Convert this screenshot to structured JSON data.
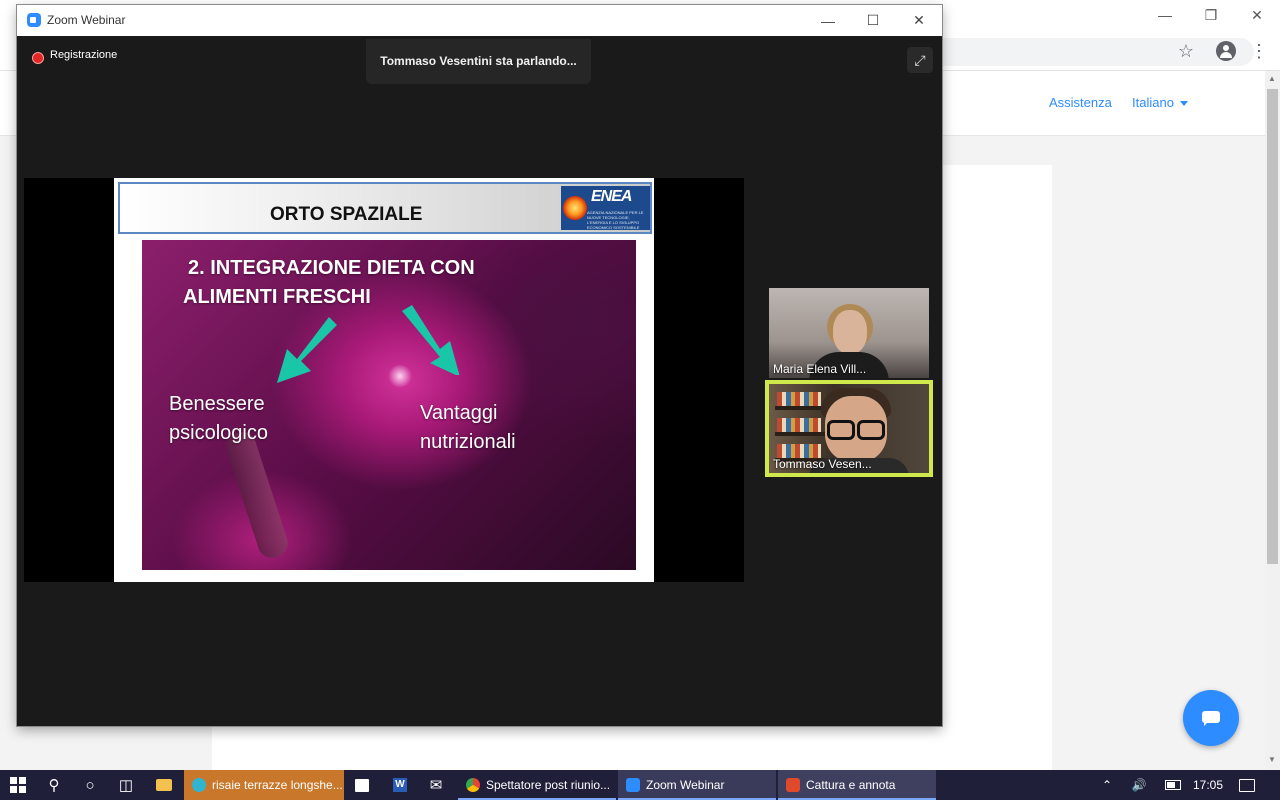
{
  "zoom": {
    "title": "Zoom Webinar",
    "recording_label": "Registrazione",
    "speaking_toast": "Tommaso Vesentini sta parlando..."
  },
  "browser": {
    "nav_links": [
      "Assistenza",
      "Italiano"
    ]
  },
  "slide": {
    "title": "ORTO SPAZIALE",
    "logo_text": "ENEA",
    "logo_subtext": "AGENZIA NAZIONALE PER LE NUOVE TECNOLOGIE, L'ENERGIA E LO SVILUPPO ECONOMICO SOSTENIBILE",
    "heading_line1": "2. INTEGRAZIONE DIETA CON",
    "heading_line2": "ALIMENTI FRESCHI",
    "caption_left_1": "Benessere",
    "caption_left_2": "psicologico",
    "caption_right_1": "Vantaggi",
    "caption_right_2": "nutrizionali",
    "arrow_color": "#19c7a8"
  },
  "participants": [
    {
      "name": "Maria Elena Vill..."
    },
    {
      "name": "Tommaso Vesen...",
      "active_speaker": true,
      "highlight_color": "#cfe84b"
    }
  ],
  "taskbar": {
    "apps": [
      {
        "label": "risaie terrazze longshe..."
      },
      {
        "label": "Spettatore post riunio..."
      },
      {
        "label": "Zoom Webinar"
      },
      {
        "label": "Cattura e annota"
      }
    ],
    "time": "17:05"
  },
  "colors": {
    "zoom_blue": "#2d8cff",
    "taskbar_bg": "#1f1f3a",
    "recording_red": "#e02828"
  }
}
